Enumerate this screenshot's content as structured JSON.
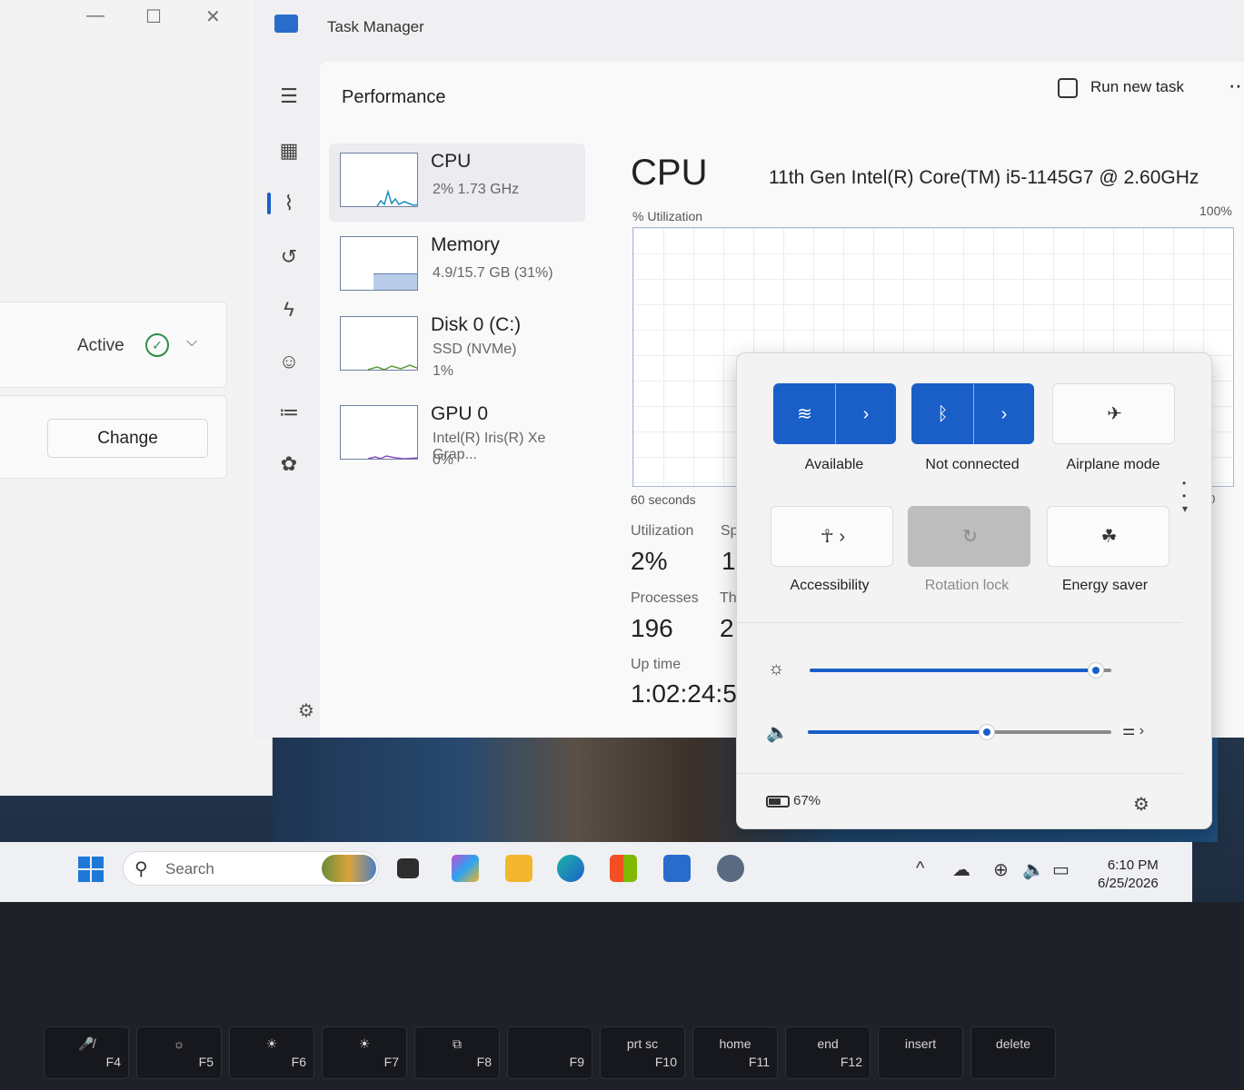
{
  "left_window": {
    "active_label": "Active",
    "change_label": "Change",
    "min": "—",
    "max": "☐",
    "close": "✕"
  },
  "task_manager": {
    "title": "Task Manager",
    "page_title": "Performance",
    "run_new_task": "Run new task",
    "more": "⋯",
    "resources": [
      {
        "name": "CPU",
        "sub1": "2%  1.73 GHz",
        "sub2": ""
      },
      {
        "name": "Memory",
        "sub1": "4.9/15.7 GB (31%)",
        "sub2": ""
      },
      {
        "name": "Disk 0 (C:)",
        "sub1": "SSD (NVMe)",
        "sub2": "1%"
      },
      {
        "name": "GPU 0",
        "sub1": "Intel(R) Iris(R) Xe Grap...",
        "sub2": "0%"
      }
    ],
    "detail": {
      "heading": "CPU",
      "model": "11th Gen Intel(R) Core(TM) i5-1145G7 @ 2.60GHz",
      "util_label": "% Utilization",
      "max_label": "100%",
      "time_label": "60 seconds",
      "zero_label": "0",
      "utilization_label": "Utilization",
      "utilization": "2%",
      "speed_label": "Sp",
      "speed": "1.",
      "processes_label": "Processes",
      "processes": "196",
      "threads_label": "Thr",
      "threads": "2",
      "uptime_label": "Up time",
      "uptime": "1:02:24:5"
    }
  },
  "quick_settings": {
    "tiles": [
      {
        "label": "Available",
        "icon": "wifi-icon"
      },
      {
        "label": "Not connected",
        "icon": "bluetooth-icon"
      },
      {
        "label": "Airplane mode",
        "icon": "airplane-icon"
      },
      {
        "label": "Accessibility",
        "icon": "accessibility-icon"
      },
      {
        "label": "Rotation lock",
        "icon": "rotation-lock-icon"
      },
      {
        "label": "Energy saver",
        "icon": "energy-saver-icon"
      }
    ],
    "brightness_level": 0.95,
    "volume_level": 0.59,
    "battery": "67%"
  },
  "taskbar": {
    "search_placeholder": "Search",
    "time": "6:10 PM",
    "date": "6/25/2026"
  },
  "keyboard": [
    {
      "top": "🎤̸",
      "bottom": "F4"
    },
    {
      "top": "☼",
      "bottom": "F5"
    },
    {
      "top": "☀",
      "bottom": "F6"
    },
    {
      "top": "☀",
      "bottom": "F7"
    },
    {
      "top": "⧉",
      "bottom": "F8"
    },
    {
      "top": "",
      "bottom": "F9"
    },
    {
      "top": "prt sc",
      "bottom": "F10"
    },
    {
      "top": "home",
      "bottom": "F11"
    },
    {
      "top": "end",
      "bottom": "F12"
    },
    {
      "top": "insert",
      "bottom": ""
    },
    {
      "top": "delete",
      "bottom": ""
    }
  ],
  "colors": {
    "accent": "#1a5fc8",
    "window": "#f9f9f9",
    "taskbar": "#eef0f4"
  }
}
